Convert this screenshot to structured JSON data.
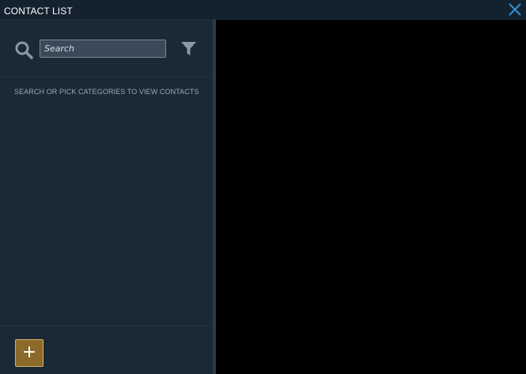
{
  "window": {
    "title": "CONTACT LIST",
    "close_icon": "close-icon"
  },
  "sidebar": {
    "search": {
      "placeholder": "Search",
      "value": "",
      "icon": "search-icon"
    },
    "filter_icon": "filter-icon",
    "hint": "SEARCH OR PICK CATEGORIES TO VIEW CONTACTS",
    "add_button": {
      "label": "+"
    }
  },
  "colors": {
    "titlebar_bg": "#14212f",
    "sidebar_bg": "#1b2836",
    "content_bg": "#000000",
    "accent": "#8b6a2a",
    "accent_border": "#d3b266",
    "close_icon": "#2f8fd6"
  }
}
